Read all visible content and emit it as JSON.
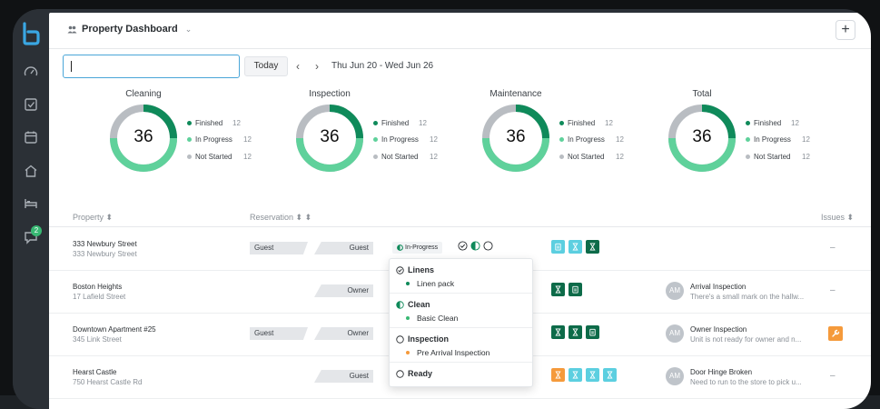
{
  "header": {
    "title": "Property Dashboard",
    "add_label": "+"
  },
  "toolbar": {
    "search_value": "",
    "today_label": "Today",
    "prev_label": "‹",
    "next_label": "›",
    "date_range": "Thu Jun 20 - Wed Jun 26"
  },
  "sidebar": {
    "chat_badge": "2"
  },
  "summaries": [
    {
      "title": "Cleaning",
      "total": "36",
      "finished": "Finished",
      "finished_count": "12",
      "in_progress": "In Progress",
      "in_progress_count": "12",
      "not_started": "Not Started",
      "not_started_count": "12"
    },
    {
      "title": "Inspection",
      "total": "36",
      "finished": "Finished",
      "finished_count": "12",
      "in_progress": "In Progress",
      "in_progress_count": "12",
      "not_started": "Not Started",
      "not_started_count": "12"
    },
    {
      "title": "Maintenance",
      "total": "36",
      "finished": "Finished",
      "finished_count": "12",
      "in_progress": "In Progress",
      "in_progress_count": "12",
      "not_started": "Not Started",
      "not_started_count": "12"
    },
    {
      "title": "Total",
      "total": "36",
      "finished": "Finished",
      "finished_count": "12",
      "in_progress": "In Progress",
      "in_progress_count": "12",
      "not_started": "Not Started",
      "not_started_count": "12"
    }
  ],
  "colors": {
    "finished": "#0f8a5a",
    "in_progress": "#5fd19b",
    "not_started": "#b9bdc2",
    "accent": "#4aa6d8"
  },
  "table": {
    "col_property": "Property ⬍",
    "col_reservation": "Reservation ⬍ ⬍",
    "col_issues": "Issues ⬍",
    "rows": [
      {
        "name": "333 Newbury Street",
        "address": "333 Newbury Street",
        "res_left": "Guest",
        "res_right": "Guest",
        "status": "In-Progress",
        "issue_title": "",
        "issue_sub": "",
        "issue_initials": ""
      },
      {
        "name": "Boston Heights",
        "address": "17 Lafield Street",
        "res_left": "",
        "res_right": "Owner",
        "status": "",
        "issue_title": "Arrival Inspection",
        "issue_sub": "There's a small mark on the hallw...",
        "issue_initials": "AM"
      },
      {
        "name": "Downtown Apartment #25",
        "address": "345 Link Street",
        "res_left": "Guest",
        "res_right": "Owner",
        "status": "",
        "issue_title": "Owner Inspection",
        "issue_sub": "Unit is not ready for owner and n...",
        "issue_initials": "AM"
      },
      {
        "name": "Hearst Castle",
        "address": "750 Hearst Castle Rd",
        "res_left": "",
        "res_right": "Guest",
        "status": "",
        "issue_title": "Door Hinge Broken",
        "issue_sub": "Need to run to the store to pick u...",
        "issue_initials": "AM"
      }
    ],
    "empty_issue": "–"
  },
  "popover": {
    "sections": [
      {
        "head": "Linens",
        "item": "Linen pack"
      },
      {
        "head": "Clean",
        "item": "Basic Clean"
      },
      {
        "head": "Inspection",
        "item": "Pre Arrival Inspection"
      },
      {
        "head": "Ready",
        "item": ""
      }
    ]
  }
}
